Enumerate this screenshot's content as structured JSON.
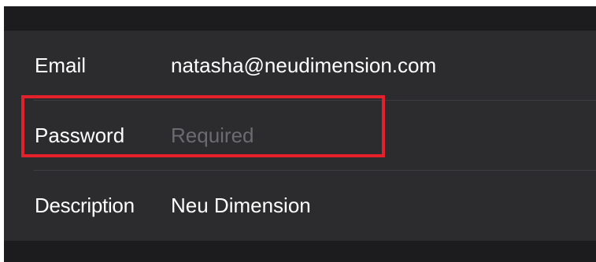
{
  "account_form": {
    "email": {
      "label": "Email",
      "value": "natasha@neudimension.com"
    },
    "password": {
      "label": "Password",
      "placeholder": "Required",
      "value": ""
    },
    "description": {
      "label": "Description",
      "value": "Neu Dimension"
    }
  },
  "annotation": {
    "highlight_color": "#e4202b",
    "highlighted_field": "password"
  }
}
